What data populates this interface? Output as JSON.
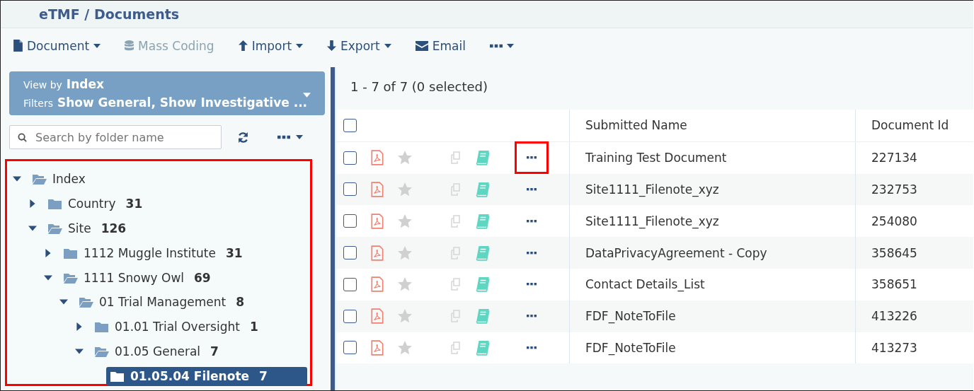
{
  "header": {
    "title": "eTMF / Documents"
  },
  "toolbar": [
    {
      "label": "Document",
      "kind": "document",
      "menu": true,
      "disabled": false
    },
    {
      "label": "Mass Coding",
      "kind": "database",
      "menu": false,
      "disabled": true
    },
    {
      "label": "Import",
      "kind": "upload",
      "menu": true,
      "disabled": false
    },
    {
      "label": "Export",
      "kind": "download",
      "menu": true,
      "disabled": false
    },
    {
      "label": "Email",
      "kind": "email",
      "menu": false,
      "disabled": false
    },
    {
      "kind": "more",
      "menu": true,
      "disabled": false
    }
  ],
  "sidebar": {
    "view_by_label": "View by",
    "view_by": "Index",
    "filters_label": "Filters",
    "filters": "Show General, Show Investigative ...",
    "search": {
      "placeholder": "Search by folder name"
    },
    "tree": {
      "highlighted": true,
      "items": [
        {
          "label": "Index",
          "expanded": true,
          "selected": false,
          "children": [
            {
              "label": "Country",
              "count": "31",
              "expanded": false,
              "selected": false
            },
            {
              "label": "Site",
              "count": "126",
              "expanded": true,
              "selected": false,
              "children": [
                {
                  "label": "1112 Muggle Institute",
                  "count": "31",
                  "expanded": false,
                  "selected": false
                },
                {
                  "label": "1111 Snowy Owl",
                  "count": "69",
                  "expanded": true,
                  "selected": false,
                  "children": [
                    {
                      "label": "01 Trial Management",
                      "count": "8",
                      "expanded": true,
                      "selected": false,
                      "children": [
                        {
                          "label": "01.01 Trial Oversight",
                          "count": "1",
                          "expanded": false,
                          "selected": false
                        },
                        {
                          "label": "01.05 General",
                          "count": "7",
                          "expanded": true,
                          "selected": false,
                          "children": [
                            {
                              "label": "01.05.04 Filenote",
                              "count": "7",
                              "selected": true
                            }
                          ]
                        }
                      ]
                    }
                  ]
                }
              ]
            }
          ]
        }
      ]
    }
  },
  "results": {
    "summary": "1 - 7 of 7 (0 selected)",
    "all_checked": false,
    "columns": [
      "Submitted Name",
      "Document Id"
    ],
    "rows": [
      {
        "checked": false,
        "starred": false,
        "menu_highlighted": true,
        "name": "Training Test Document",
        "id": "227134"
      },
      {
        "checked": false,
        "starred": false,
        "menu_highlighted": false,
        "name": "Site1111_Filenote_xyz",
        "id": "232753"
      },
      {
        "checked": false,
        "starred": false,
        "menu_highlighted": false,
        "name": "Site1111_Filenote_xyz",
        "id": "254080"
      },
      {
        "checked": false,
        "starred": false,
        "menu_highlighted": false,
        "name": "DataPrivacyAgreement - Copy",
        "id": "358645"
      },
      {
        "checked": false,
        "starred": false,
        "menu_highlighted": false,
        "name": "Contact Details_List",
        "id": "358651"
      },
      {
        "checked": false,
        "starred": false,
        "menu_highlighted": false,
        "name": "FDF_NoteToFile",
        "id": "413226"
      },
      {
        "checked": false,
        "starred": false,
        "menu_highlighted": false,
        "name": "FDF_NoteToFile",
        "id": "413273"
      }
    ]
  }
}
